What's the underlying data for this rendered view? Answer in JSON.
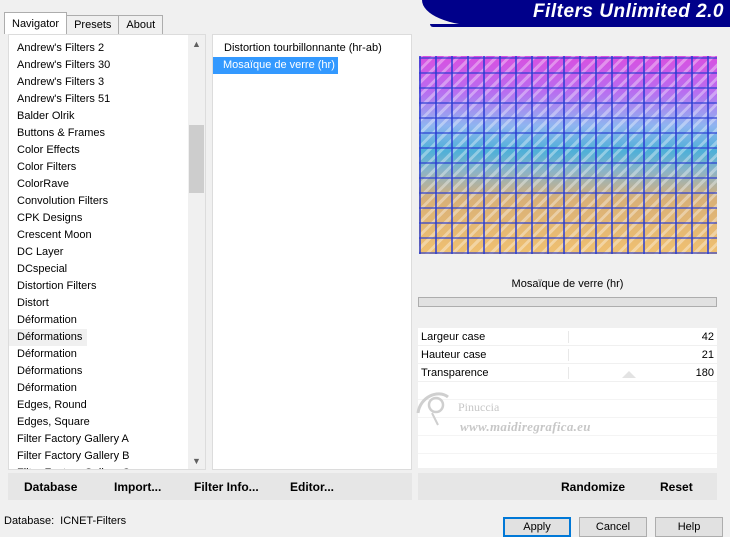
{
  "tabs": [
    "Navigator",
    "Presets",
    "About"
  ],
  "banner_title": "Filters Unlimited 2.0",
  "categories": [
    "Andrew's Filters 2",
    "Andrew's Filters 30",
    "Andrew's Filters 3",
    "Andrew's Filters 51",
    "Balder Olrik",
    "Buttons & Frames",
    "Color Effects",
    "Color Filters",
    "ColorRave",
    "Convolution Filters",
    "CPK Designs",
    "Crescent Moon",
    "DC Layer",
    "DCspecial",
    "Distortion Filters",
    "Distort",
    "Déformation",
    "Déformations",
    "Déformation",
    "Déformations",
    "Déformation",
    "Edges, Round",
    "Edges, Square",
    "Filter Factory Gallery A",
    "Filter Factory Gallery B",
    "Filter Factory Gallery C"
  ],
  "highlighted_category_index": 17,
  "filters": [
    "Distortion tourbillonnante (hr-ab)",
    "Mosaïque de verre (hr)"
  ],
  "selected_filter_index": 1,
  "param_panel_title": "Mosaïque de verre (hr)",
  "params": [
    {
      "name": "Largeur case",
      "value": "42"
    },
    {
      "name": "Hauteur case",
      "value": "21"
    },
    {
      "name": "Transparence",
      "value": "180"
    }
  ],
  "watermark": {
    "name": "Pinuccia",
    "site": "www.maidiregrafica.eu"
  },
  "left_buttons": [
    "Database",
    "Import...",
    "Filter Info...",
    "Editor..."
  ],
  "right_buttons": [
    "Randomize",
    "Reset"
  ],
  "status": {
    "label": "Database:",
    "value": "ICNET-Filters"
  },
  "dialog_buttons": [
    "Apply",
    "Cancel",
    "Help"
  ],
  "colors": {
    "selection": "#3399ff",
    "banner": "#00008a"
  }
}
